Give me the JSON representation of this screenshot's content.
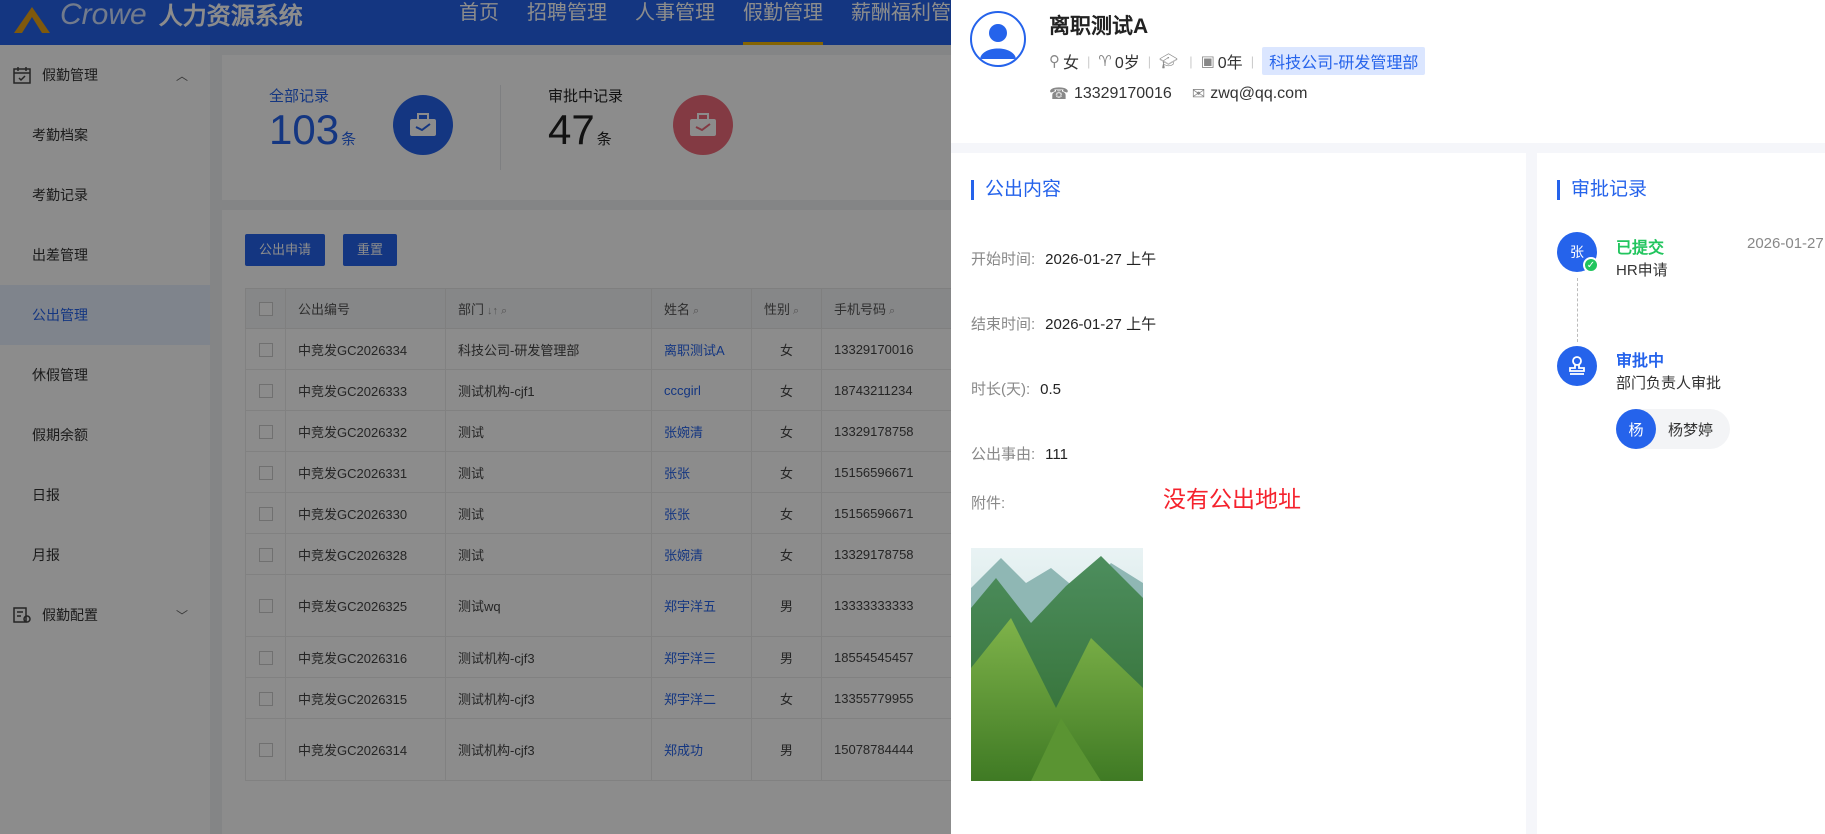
{
  "header": {
    "brand": "Crowe",
    "title": "人力资源系统",
    "nav": [
      {
        "label": "首页"
      },
      {
        "label": "招聘管理"
      },
      {
        "label": "人事管理"
      },
      {
        "label": "假勤管理"
      },
      {
        "label": "薪酬福利管"
      }
    ],
    "active_nav": "假勤管理",
    "colors": {
      "primary": "#2563eb",
      "active_underline": "#f2b705"
    }
  },
  "sidebar": {
    "group1": {
      "label": "假勤管理",
      "icon": "calendar-icon",
      "chevron": "chevron-up-icon"
    },
    "items": [
      {
        "label": "考勤档案"
      },
      {
        "label": "考勤记录"
      },
      {
        "label": "出差管理"
      },
      {
        "label": "公出管理"
      },
      {
        "label": "休假管理"
      },
      {
        "label": "假期余额"
      },
      {
        "label": "日报"
      },
      {
        "label": "月报"
      }
    ],
    "active_item": "公出管理",
    "group2": {
      "label": "假勤配置",
      "icon": "config-icon",
      "chevron": "chevron-down-icon"
    }
  },
  "stats": {
    "all": {
      "label": "全部记录",
      "value": "103",
      "unit": "条",
      "icon": "briefcase-icon"
    },
    "pending": {
      "label": "审批中记录",
      "value": "47",
      "unit": "条",
      "icon": "briefcase-icon"
    }
  },
  "toolbar": {
    "apply_label": "公出申请",
    "reset_label": "重置"
  },
  "table": {
    "headers": [
      "公出编号",
      "部门",
      "姓名",
      "性别",
      "手机号码"
    ],
    "rows": [
      {
        "id": "中竞发GC2026334",
        "dept": "科技公司-研发管理部",
        "name": "离职测试A",
        "gender": "女",
        "phone": "13329170016"
      },
      {
        "id": "中竞发GC2026333",
        "dept": "测试机构-cjf1",
        "name": "cccgirl",
        "gender": "女",
        "phone": "18743211234"
      },
      {
        "id": "中竞发GC2026332",
        "dept": "测试",
        "name": "张婉清",
        "gender": "女",
        "phone": "13329178758"
      },
      {
        "id": "中竞发GC2026331",
        "dept": "测试",
        "name": "张张",
        "gender": "女",
        "phone": "15156596671"
      },
      {
        "id": "中竞发GC2026330",
        "dept": "测试",
        "name": "张张",
        "gender": "女",
        "phone": "15156596671"
      },
      {
        "id": "中竞发GC2026328",
        "dept": "测试",
        "name": "张婉清",
        "gender": "女",
        "phone": "13329178758"
      },
      {
        "id": "中竞发GC2026325",
        "dept": "测试wq",
        "name": "郑宇洋五",
        "gender": "男",
        "phone": "13333333333"
      },
      {
        "id": "中竞发GC2026316",
        "dept": "测试机构-cjf3",
        "name": "郑宇洋三",
        "gender": "男",
        "phone": "18554545457"
      },
      {
        "id": "中竞发GC2026315",
        "dept": "测试机构-cjf3",
        "name": "郑宇洋二",
        "gender": "女",
        "phone": "13355779955"
      },
      {
        "id": "中竞发GC2026314",
        "dept": "测试机构-cjf3",
        "name": "郑成功",
        "gender": "男",
        "phone": "15078784444"
      }
    ]
  },
  "drawer": {
    "profile": {
      "name": "离职测试A",
      "gender": "女",
      "age": "0岁",
      "years": "0年",
      "dept": "科技公司-研发管理部",
      "phone": "13329170016",
      "email": "zwq@qq.com"
    },
    "content": {
      "title": "公出内容",
      "start_label": "开始时间:",
      "start_value": "2026-01-27 上午",
      "end_label": "结束时间:",
      "end_value": "2026-01-27 上午",
      "duration_label": "时长(天):",
      "duration_value": "0.5",
      "reason_label": "公出事由:",
      "reason_value": "111",
      "attach_label": "附件:",
      "no_address_note": "没有公出地址"
    },
    "approval": {
      "title": "审批记录",
      "steps": [
        {
          "avatar": "张",
          "status": "已提交",
          "desc": "HR申请",
          "date": "2026-01-27",
          "status_color": "#22c55e"
        },
        {
          "avatar": "stamp-icon",
          "status": "审批中",
          "desc": "部门负责人审批",
          "status_color": "#2563eb"
        }
      ],
      "approver": {
        "avatar": "杨",
        "name": "杨梦婷"
      }
    }
  }
}
